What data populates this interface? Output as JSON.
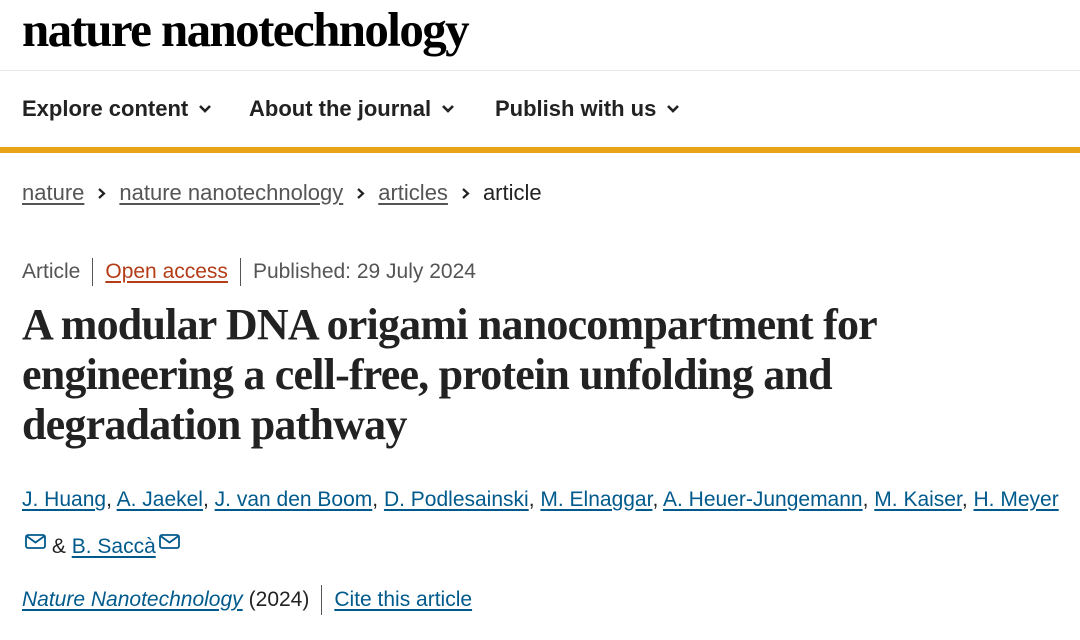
{
  "header": {
    "logo": "nature nanotechnology"
  },
  "nav": {
    "items": [
      {
        "label": "Explore content"
      },
      {
        "label": "About the journal"
      },
      {
        "label": "Publish with us"
      }
    ]
  },
  "breadcrumb": {
    "items": [
      "nature",
      "nature nanotechnology",
      "articles"
    ],
    "current": "article"
  },
  "article": {
    "type": "Article",
    "access": "Open access",
    "published": "Published: 29 July 2024",
    "title": "A modular DNA origami nanocompartment for engineering a cell-free, protein unfolding and degradation pathway",
    "authors": [
      "J. Huang",
      "A. Jaekel",
      "J. van den Boom",
      "D. Podlesainski",
      "M. Elnaggar",
      "A. Heuer-Jungemann",
      "M. Kaiser",
      "H. Meyer",
      "B. Saccà"
    ],
    "author_separator": ",",
    "author_and": "&",
    "journal": "Nature Nanotechnology",
    "year": "(2024)",
    "cite_label": "Cite this article"
  },
  "icons": {
    "chevron": "chevron-down-icon",
    "mail": "mail-icon",
    "breadcrumb_sep": "chevron-right-icon"
  },
  "colors": {
    "accent_bar": "#e8a317",
    "link": "#005a8c",
    "open_access": "#b43c17"
  }
}
